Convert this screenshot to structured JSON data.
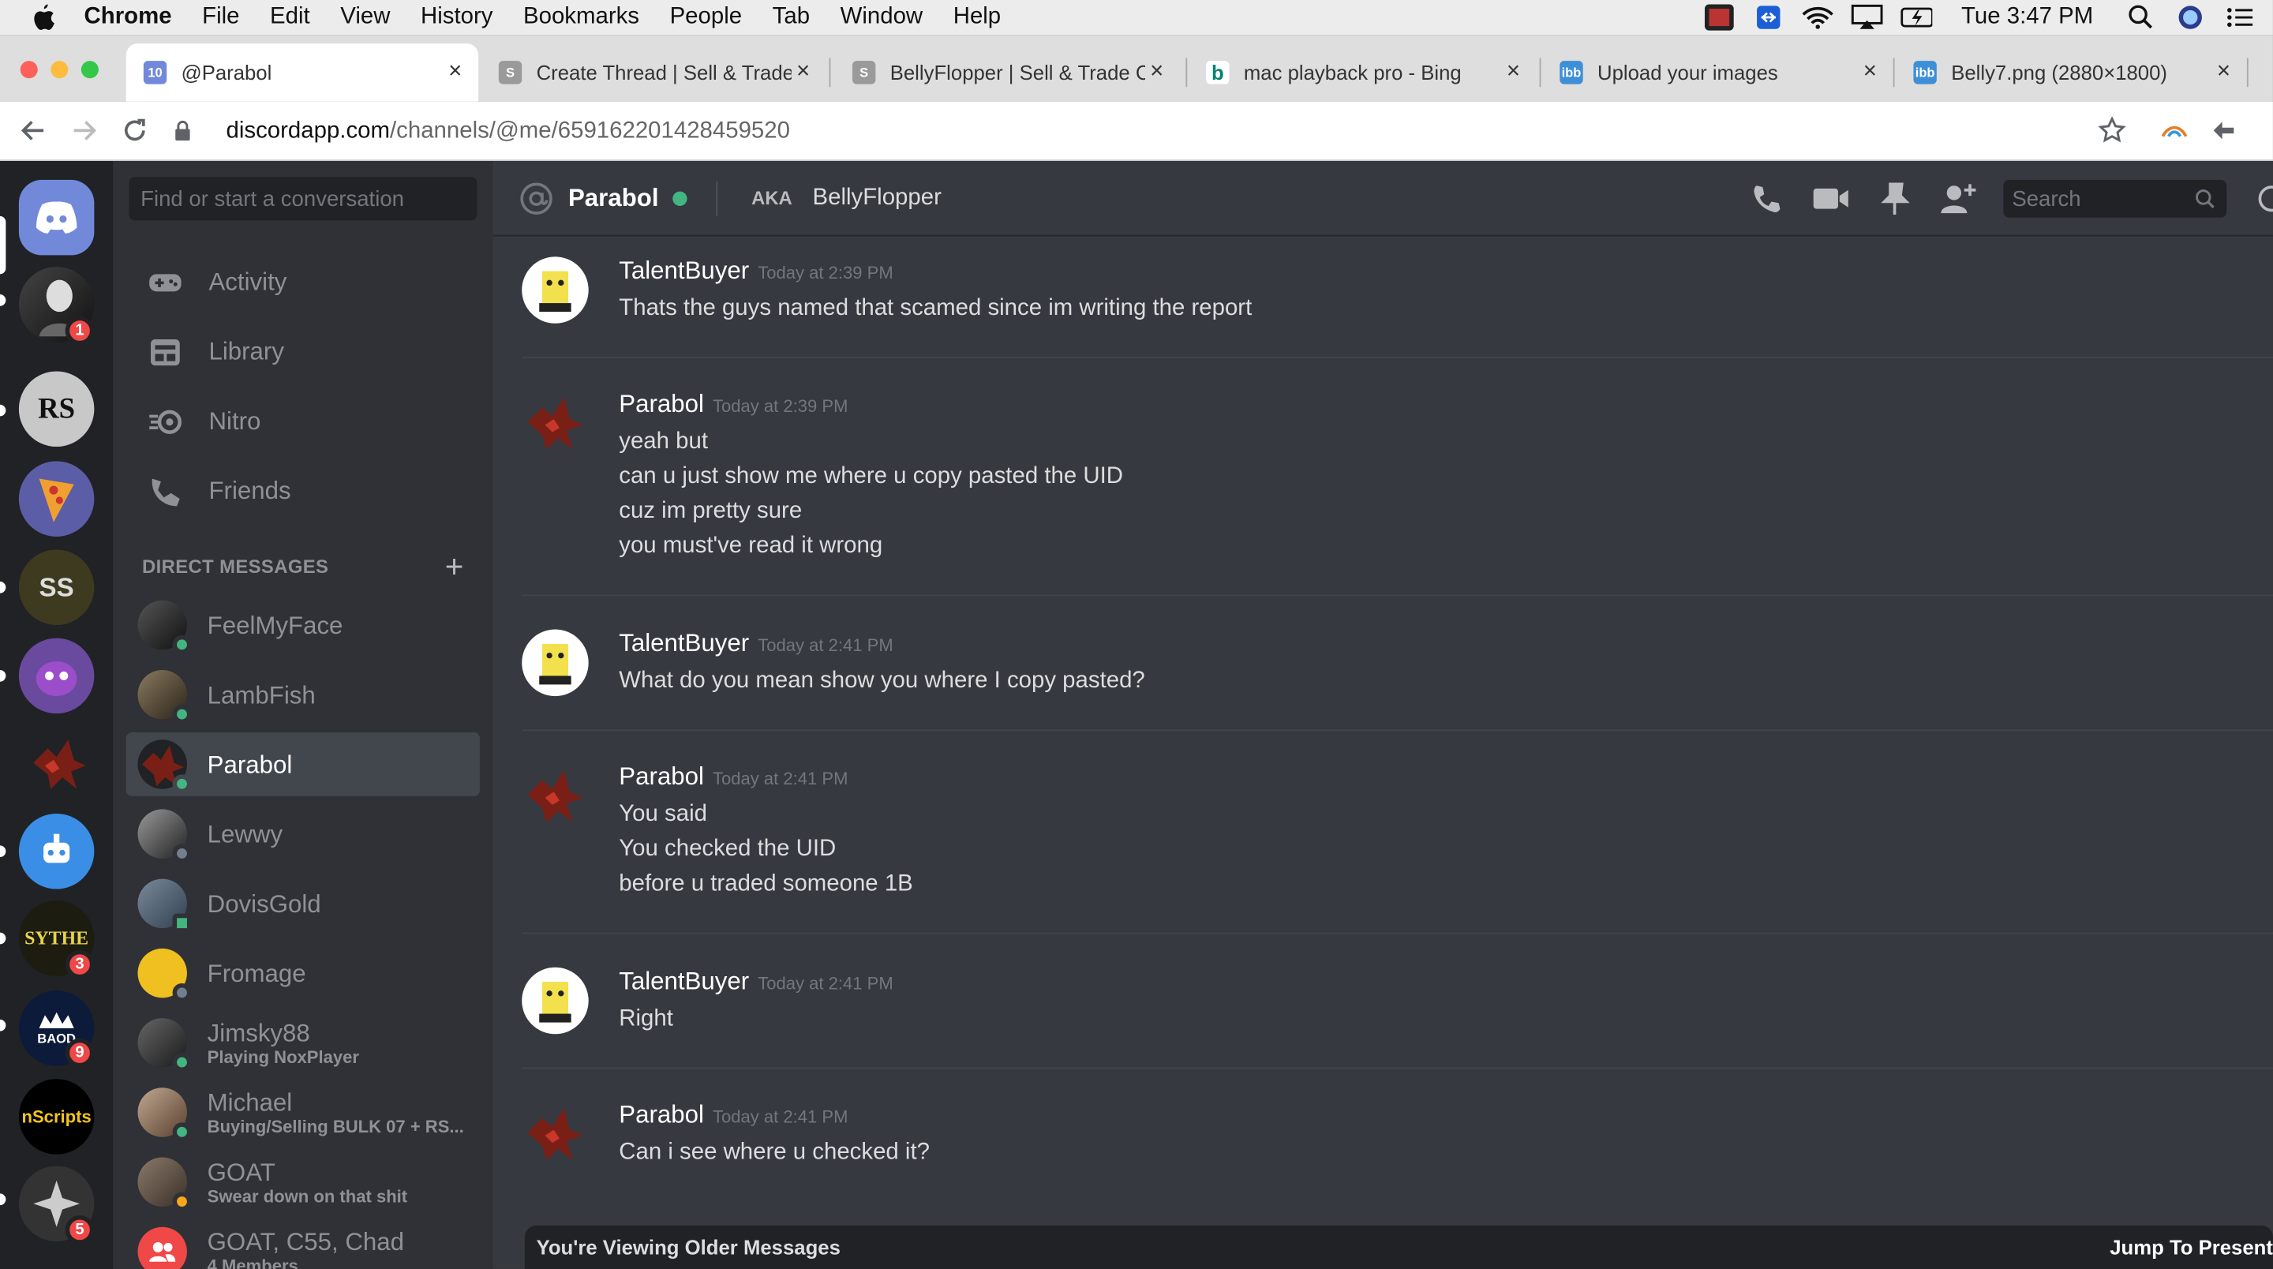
{
  "menubar": {
    "app": "Chrome",
    "items": [
      "File",
      "Edit",
      "View",
      "History",
      "Bookmarks",
      "People",
      "Tab",
      "Window",
      "Help"
    ],
    "clock": "Tue 3:47 PM"
  },
  "tabs": [
    {
      "title": "@Parabol",
      "badge": "10"
    },
    {
      "title": "Create Thread | Sell & Trade"
    },
    {
      "title": "BellyFlopper | Sell & Trade C"
    },
    {
      "title": "mac playback pro - Bing"
    },
    {
      "title": "Upload your images"
    },
    {
      "title": "Belly7.png (2880×1800)"
    }
  ],
  "address": {
    "host": "discordapp.com",
    "path": "/channels/@me/659162201428459520"
  },
  "colors": {
    "accent": "#7289da",
    "online": "#43b581",
    "badge": "#f04747",
    "bg": "#36393f"
  },
  "server_badges": [
    "1",
    "3",
    "9",
    "5"
  ],
  "servers": {
    "sythe": "SYTHE",
    "baod": "BAOD",
    "nscripts": "nScripts"
  },
  "sidebar": {
    "search_placeholder": "Find or start a conversation",
    "nav": [
      "Activity",
      "Library",
      "Nitro",
      "Friends"
    ],
    "dm_header": "DIRECT MESSAGES",
    "dms": [
      {
        "name": "FeelMyFace",
        "sub": ""
      },
      {
        "name": "LambFish",
        "sub": ""
      },
      {
        "name": "Parabol",
        "sub": ""
      },
      {
        "name": "Lewwy",
        "sub": ""
      },
      {
        "name": "DovisGold",
        "sub": ""
      },
      {
        "name": "Fromage",
        "sub": ""
      },
      {
        "name": "Jimsky88",
        "sub": "Playing NoxPlayer"
      },
      {
        "name": "Michael",
        "sub": "Buying/Selling BULK 07 + RS..."
      },
      {
        "name": "GOAT",
        "sub": "Swear down on that shit"
      },
      {
        "name": "GOAT, C55, Chad",
        "sub": "4 Members"
      }
    ]
  },
  "chat": {
    "title": "Parabol",
    "aka_label": "AKA",
    "aka_name": "BellyFlopper",
    "search_placeholder": "Search",
    "messages": [
      {
        "author": "TalentBuyer",
        "time": "Today at 2:39 PM",
        "lines": [
          "Thats the guys named that scamed since im writing the report"
        ]
      },
      {
        "author": "Parabol",
        "time": "Today at 2:39 PM",
        "lines": [
          "yeah but",
          "can u just show me where u copy pasted the UID",
          "cuz im pretty sure",
          "you must've read it wrong"
        ]
      },
      {
        "author": "TalentBuyer",
        "time": "Today at 2:41 PM",
        "lines": [
          "What do you mean show you where I copy pasted?"
        ]
      },
      {
        "author": "Parabol",
        "time": "Today at 2:41 PM",
        "lines": [
          "You said",
          "You checked the UID",
          "before u traded someone 1B"
        ]
      },
      {
        "author": "TalentBuyer",
        "time": "Today at 2:41 PM",
        "lines": [
          "Right"
        ]
      },
      {
        "author": "Parabol",
        "time": "Today at 2:41 PM",
        "lines": [
          "Can i see where u checked it?"
        ]
      }
    ],
    "older_notice": "You're Viewing Older Messages",
    "jump_label": "Jump To Present"
  }
}
